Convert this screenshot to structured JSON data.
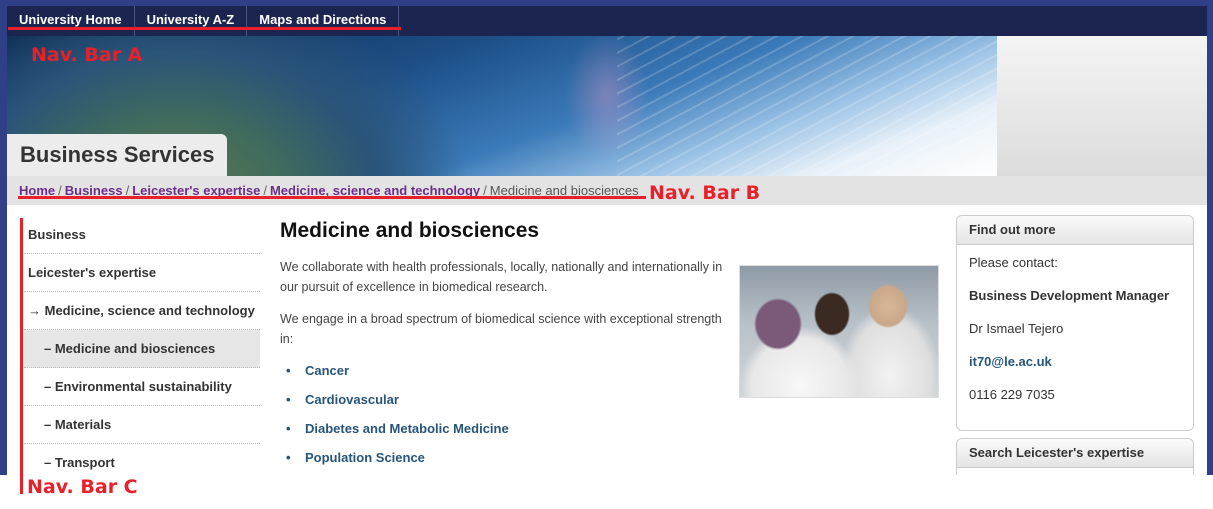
{
  "top_nav": {
    "items": [
      "University Home",
      "University A-Z",
      "Maps and Directions"
    ]
  },
  "site_title": "Business Services",
  "breadcrumb": {
    "links": [
      "Home",
      "Business",
      "Leicester's expertise",
      "Medicine, science and technology"
    ],
    "current": "Medicine and biosciences"
  },
  "left_nav": {
    "items": [
      {
        "label": "Business"
      },
      {
        "label": "Leicester's expertise"
      },
      {
        "label": "→ Medicine, science and technology"
      },
      {
        "label": "–  Medicine and biosciences"
      },
      {
        "label": "–  Environmental sustainability"
      },
      {
        "label": "–  Materials"
      },
      {
        "label": "–  Transport"
      }
    ]
  },
  "main": {
    "heading": "Medicine and biosciences",
    "paragraphs": [
      "We collaborate with health professionals, locally, nationally and internationally in our pursuit of excellence in biomedical research.",
      "We engage in a broad spectrum of biomedical science with exceptional strength in:"
    ],
    "links": [
      "Cancer",
      "Cardiovascular",
      "Diabetes and Metabolic Medicine",
      "Population Science"
    ]
  },
  "sidebar": {
    "find_out_more": {
      "title": "Find out more",
      "intro": "Please contact:",
      "role": "Business Development Manager",
      "name": "Dr Ismael Tejero",
      "email": "it70@le.ac.uk",
      "phone": "0116 229 7035"
    },
    "search": {
      "title": "Search Leicester's expertise"
    }
  },
  "annotations": {
    "nav_a": "Nav. Bar A",
    "nav_b": "Nav. Bar B",
    "nav_c": "Nav. Bar C"
  },
  "colors": {
    "annotation_red": "#e8202a",
    "frame_blue": "#2f3f88",
    "top_nav_bg": "#1c2550",
    "breadcrumb_link": "#6b2f8a",
    "content_link": "#27557a"
  }
}
